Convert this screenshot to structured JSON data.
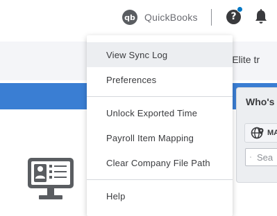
{
  "header": {
    "product_link_label": "QuickBooks",
    "product_logo_icon": "quickbooks-logo-icon",
    "help_icon": "help-icon",
    "help_symbol": "?",
    "notification_icon": "bell-icon",
    "notification_dot_color": "#0077c5"
  },
  "banner": {
    "text": "ur Elite tr"
  },
  "accent_color": "#3a7ed3",
  "menu": {
    "items": [
      {
        "label": "View Sync Log",
        "highlighted": true
      },
      {
        "label": "Preferences"
      },
      {
        "label": "Unlock Exported Time"
      },
      {
        "label": "Payroll Item Mapping"
      },
      {
        "label": "Clear Company File Path"
      },
      {
        "label": "Help"
      }
    ]
  },
  "whos_widget": {
    "title": "Who's",
    "map_button_label": "MA",
    "map_icon": "globe-pin-icon",
    "search_icon": "search-icon",
    "search_placeholder": "Sea"
  },
  "illustration": {
    "icon": "time-clock-kiosk-icon"
  }
}
